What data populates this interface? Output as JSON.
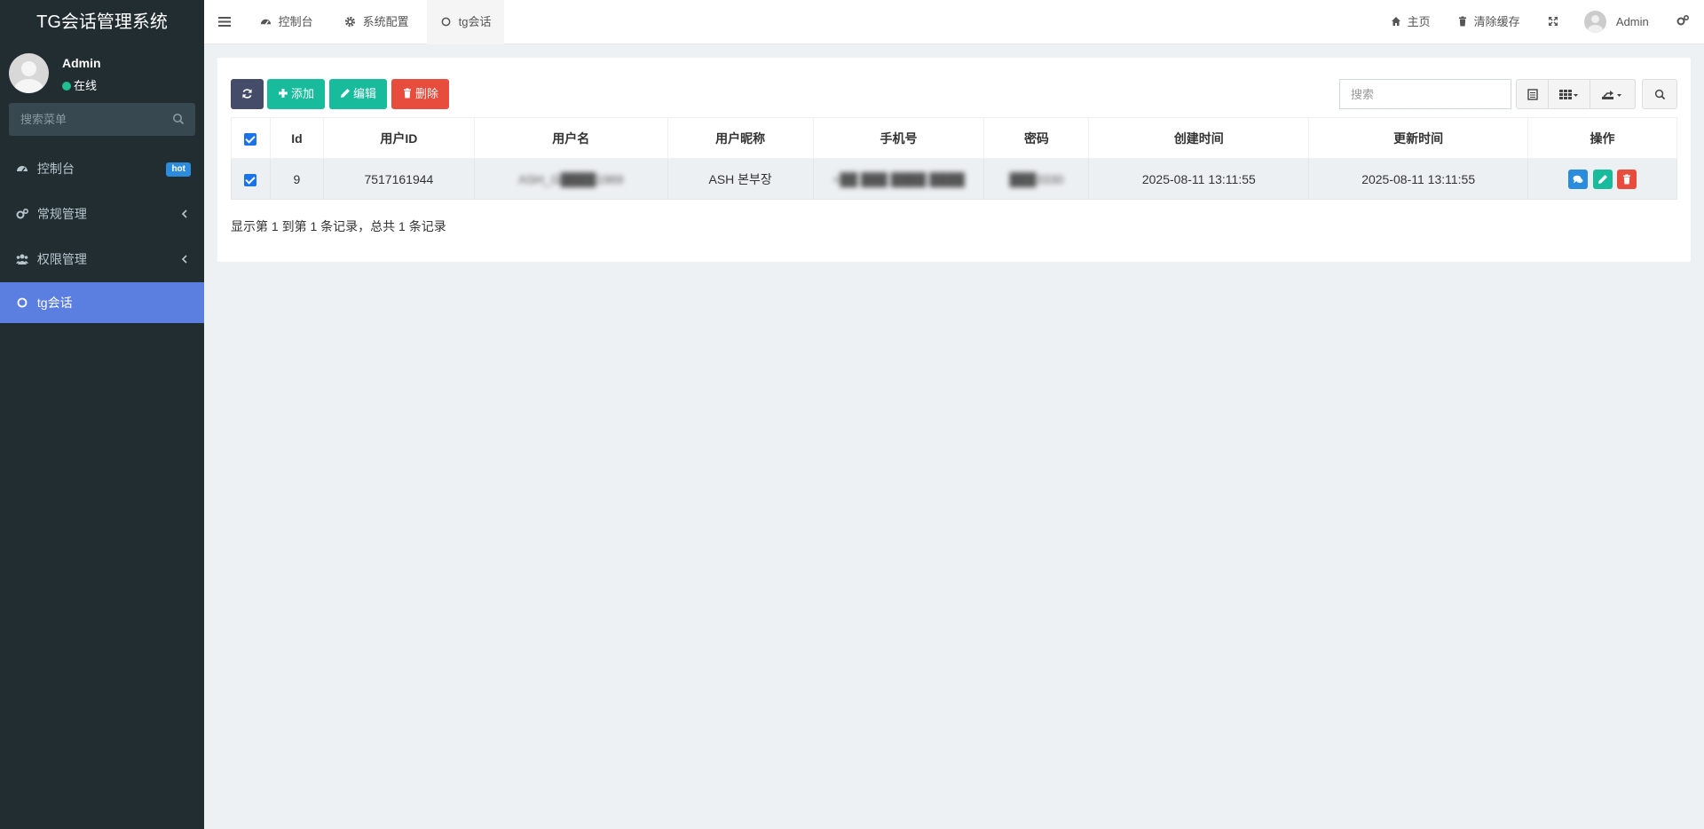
{
  "app": {
    "title": "TG会话管理系统"
  },
  "user": {
    "name": "Admin",
    "status": "在线"
  },
  "sidebar": {
    "search_placeholder": "搜索菜单",
    "items": [
      {
        "label": "控制台",
        "badge": "hot",
        "icon": "dashboard-icon"
      },
      {
        "label": "常规管理",
        "icon": "cogs-icon",
        "has_children": true
      },
      {
        "label": "权限管理",
        "icon": "users-icon",
        "has_children": true
      },
      {
        "label": "tg会话",
        "icon": "circle-icon",
        "active": true
      }
    ]
  },
  "topbar": {
    "tabs": [
      {
        "label": "控制台",
        "icon": "dashboard-icon"
      },
      {
        "label": "系统配置",
        "icon": "gear-icon"
      },
      {
        "label": "tg会话",
        "icon": "circle-icon",
        "active": true
      }
    ],
    "right": {
      "home": "主页",
      "clear_cache": "清除缓存",
      "user": "Admin"
    }
  },
  "toolbar": {
    "add": "添加",
    "edit": "编辑",
    "delete": "删除",
    "search_placeholder": "搜索"
  },
  "table": {
    "columns": [
      "Id",
      "用户ID",
      "用户名",
      "用户昵称",
      "手机号",
      "密码",
      "创建时间",
      "更新时间",
      "操作"
    ],
    "rows": [
      {
        "id": "9",
        "user_id": "7517161944",
        "username": "ASH_G████1969",
        "nickname": "ASH 본부장",
        "phone": "+██ ███ ████ ████",
        "password": "███3330",
        "created": "2025-08-11 13:11:55",
        "updated": "2025-08-11 13:11:55"
      }
    ]
  },
  "pagination": {
    "summary": "显示第 1 到第 1 条记录，总共 1 条记录"
  },
  "colors": {
    "sidebar_bg": "#222d32",
    "active_menu": "#5b7fe0",
    "success": "#18bc9c",
    "danger": "#e74c3c",
    "primary": "#2b8bdc",
    "dark_btn": "#444c69"
  }
}
